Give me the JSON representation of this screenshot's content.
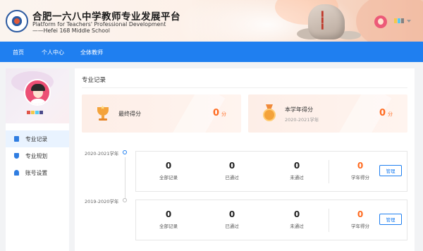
{
  "header": {
    "title": "合肥一六八中学教师专业发展平台",
    "subtitle_en": "Platform for Teachers' Professional Development",
    "subtitle_school": "——Hefei 168 Middle School",
    "logo_icon": "school-emblem-icon",
    "avatar_icon": "user-avatar-icon",
    "swatch_colors": [
      "#f2c94c",
      "#56ccf2",
      "#828282"
    ]
  },
  "nav": {
    "items": [
      {
        "label": "首页"
      },
      {
        "label": "个人中心"
      },
      {
        "label": "全体教师"
      }
    ],
    "bg_color": "#1f7ff0"
  },
  "sidebar": {
    "swatch_colors": [
      "#e0564a",
      "#f2c94c",
      "#56ccf2",
      "#4a4a8a"
    ],
    "menu": [
      {
        "label": "专业记录",
        "icon": "document-icon",
        "active": true
      },
      {
        "label": "专业规划",
        "icon": "shield-icon",
        "active": false
      },
      {
        "label": "账号设置",
        "icon": "user-icon",
        "active": false
      }
    ]
  },
  "main": {
    "section_title": "专业记录",
    "score_cards": [
      {
        "label": "最终得分",
        "sub": "",
        "value": "0",
        "unit": "分",
        "icon": "trophy-icon"
      },
      {
        "label": "本学年得分",
        "sub": "2020-2021学年",
        "value": "0",
        "unit": "分",
        "icon": "medal-icon"
      }
    ],
    "records": [
      {
        "year": "2020-2021学年",
        "current": true,
        "stats": [
          {
            "value": "0",
            "label": "全部记录"
          },
          {
            "value": "0",
            "label": "已通过"
          },
          {
            "value": "0",
            "label": "未通过"
          },
          {
            "value": "0",
            "label": "学年得分"
          }
        ],
        "button": "管理"
      },
      {
        "year": "2019-2020学年",
        "current": false,
        "stats": [
          {
            "value": "0",
            "label": "全部记录"
          },
          {
            "value": "0",
            "label": "已通过"
          },
          {
            "value": "0",
            "label": "未通过"
          },
          {
            "value": "0",
            "label": "学年得分"
          }
        ],
        "button": "管理"
      }
    ],
    "accent_color": "#ff6a1f"
  }
}
